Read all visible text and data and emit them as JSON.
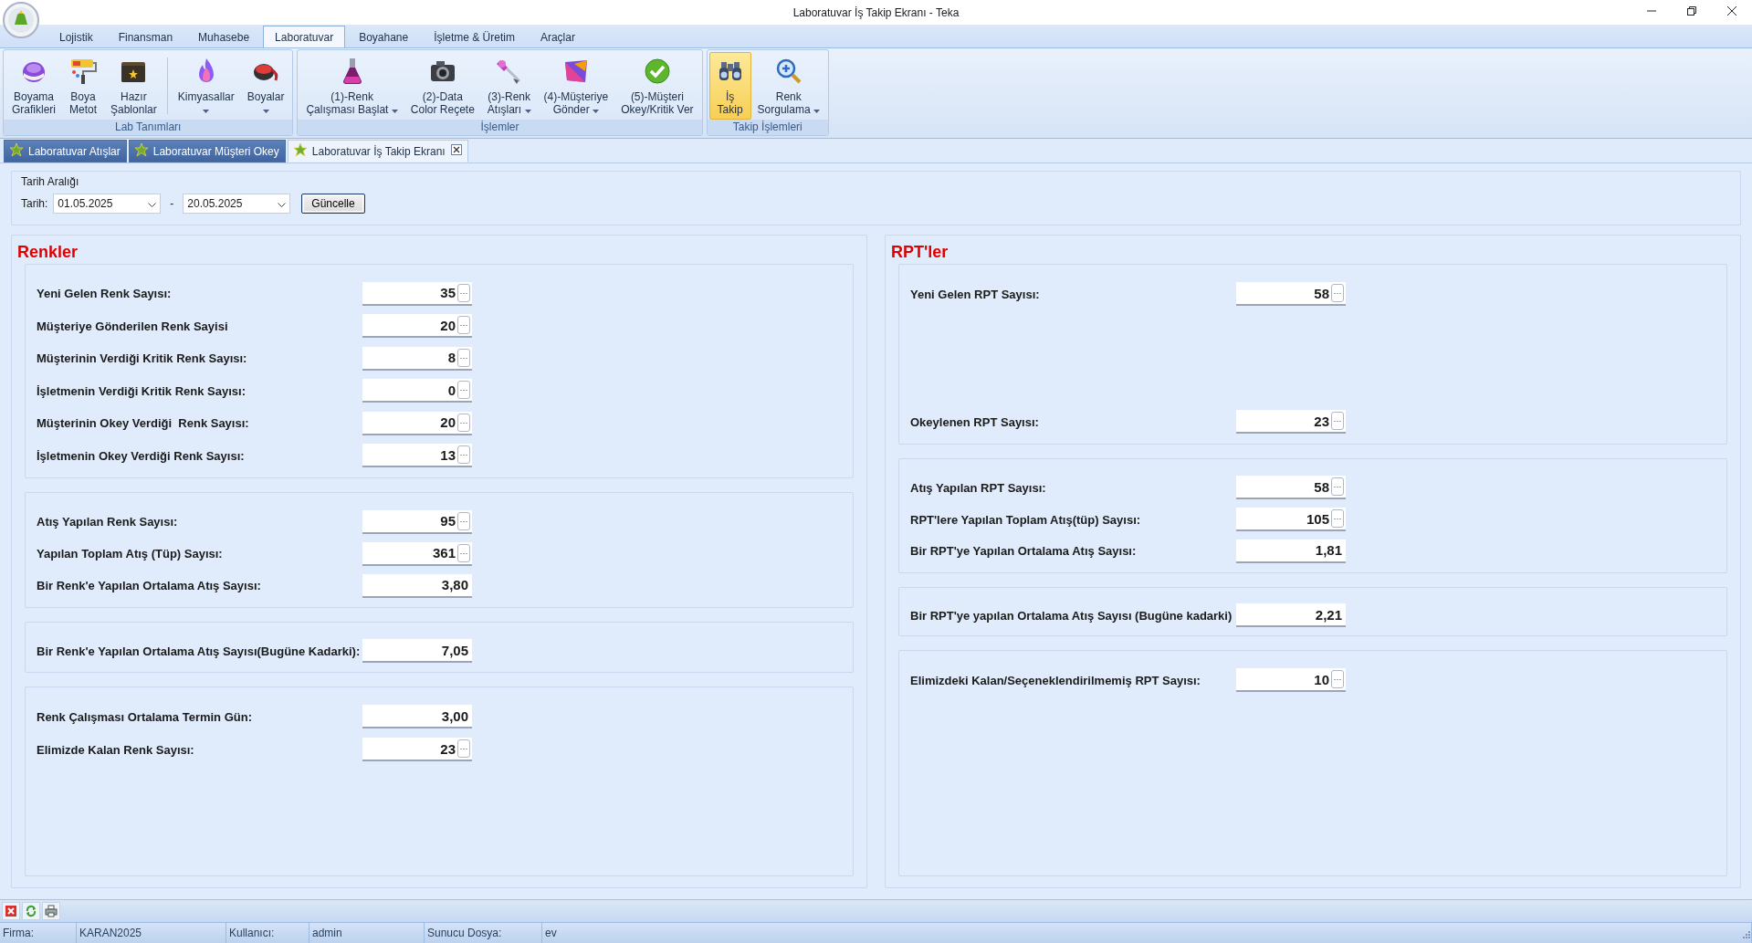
{
  "window": {
    "title": "Laboratuvar İş Takip Ekranı - Teka"
  },
  "menu_tabs": [
    {
      "label": "Lojistik",
      "selected": false
    },
    {
      "label": "Finansman",
      "selected": false
    },
    {
      "label": "Muhasebe",
      "selected": false
    },
    {
      "label": "Laboratuvar",
      "selected": true
    },
    {
      "label": "Boyahane",
      "selected": false
    },
    {
      "label": "İşletme & Üretim",
      "selected": false
    },
    {
      "label": "Araçlar",
      "selected": false
    }
  ],
  "ribbon_groups": [
    {
      "title": "Lab Tanımları",
      "sections": [
        [
          {
            "lines": [
              "Boyama",
              "Grafikleri"
            ],
            "dropdown": false,
            "selected": false
          },
          {
            "lines": [
              "Boya",
              "Metot"
            ],
            "dropdown": false,
            "selected": false
          },
          {
            "lines": [
              "Hazır",
              "Şablonlar"
            ],
            "dropdown": false,
            "selected": false
          }
        ],
        [
          {
            "lines": [
              "Kimyasallar"
            ],
            "dropdown": true,
            "selected": false
          },
          {
            "lines": [
              "Boyalar"
            ],
            "dropdown": true,
            "selected": false
          }
        ]
      ]
    },
    {
      "title": "İşlemler",
      "sections": [
        [
          {
            "lines": [
              "(1)-Renk",
              "Çalışması Başlat"
            ],
            "dropdown": true,
            "selected": false
          },
          {
            "lines": [
              "(2)-Data",
              "Color Reçete"
            ],
            "dropdown": false,
            "selected": false
          },
          {
            "lines": [
              "(3)-Renk",
              "Atışları"
            ],
            "dropdown": true,
            "selected": false
          },
          {
            "lines": [
              "(4)-Müşteriye",
              "Gönder"
            ],
            "dropdown": true,
            "selected": false
          },
          {
            "lines": [
              "(5)-Müşteri",
              "Okey/Kritik Ver"
            ],
            "dropdown": false,
            "selected": false
          }
        ]
      ]
    },
    {
      "title": "Takip İşlemleri",
      "sections": [
        [
          {
            "lines": [
              "İş",
              "Takip"
            ],
            "dropdown": false,
            "selected": true
          },
          {
            "lines": [
              "Renk",
              "Sorgulama"
            ],
            "dropdown": true,
            "selected": false
          }
        ]
      ]
    }
  ],
  "document_tabs": [
    {
      "label": "Laboratuvar Atışlar",
      "selected": false,
      "closable": false
    },
    {
      "label": "Laboratuvar Müşteri Okey",
      "selected": false,
      "closable": false
    },
    {
      "label": "Laboratuvar İş Takip Ekranı",
      "selected": true,
      "closable": true
    }
  ],
  "date_filter": {
    "title": "Tarih Aralığı",
    "label": "Tarih:",
    "from": "01.05.2025",
    "separator": "-",
    "to": "20.05.2025",
    "button": "Güncelle"
  },
  "panels": [
    {
      "title": "Renkler",
      "groups": [
        {
          "rows": [
            {
              "label": "Yeni Gelen Renk Sayısı:",
              "value": "35",
              "button": "···"
            },
            {
              "label": "Müşteriye Gönderilen Renk Sayisi",
              "value": "20",
              "button": "···"
            },
            {
              "label": "Müşterinin Verdiği Kritik Renk Sayısı:",
              "value": "8",
              "button": "···"
            },
            {
              "label": "İşletmenin Verdiği Kritik Renk Sayısı:",
              "value": "0",
              "button": "···"
            },
            {
              "label": "Müşterinin Okey Verdiği  Renk Sayısı:",
              "value": "20",
              "button": "···"
            },
            {
              "label": "İşletmenin Okey Verdiği Renk Sayısı:",
              "value": "13",
              "button": "···"
            }
          ]
        },
        {
          "rows": [
            {
              "label": "Atış Yapılan Renk Sayısı:",
              "value": "95",
              "button": "···"
            },
            {
              "label": "Yapılan Toplam Atış (Tüp) Sayısı:",
              "value": "361",
              "button": "···"
            },
            {
              "label": "Bir Renk'e Yapılan Ortalama Atış Sayısı:",
              "value": "3,80"
            }
          ]
        },
        {
          "rows": [
            {
              "label": "Bir Renk'e Yapılan Ortalama Atış Sayısı(Bugüne Kadarki):",
              "value": "7,05"
            }
          ]
        },
        {
          "rows": [
            {
              "label": "Renk Çalışması Ortalama Termin Gün:",
              "value": "3,00"
            },
            {
              "label": "Elimizde Kalan Renk Sayısı:",
              "value": "23",
              "button": "···"
            }
          ]
        }
      ]
    },
    {
      "title": "RPT'ler",
      "groups": [
        {
          "rows": [
            {
              "label": "Yeni Gelen RPT Sayısı:",
              "value": "58",
              "button": "···"
            },
            {
              "label": "Okeylenen RPT Sayısı:",
              "value": "23",
              "button": "···"
            }
          ]
        },
        {
          "rows": [
            {
              "label": "Atış Yapılan RPT Sayısı:",
              "value": "58",
              "button": "···"
            },
            {
              "label": "RPT'lere Yapılan Toplam Atış(tüp) Sayısı:",
              "value": "105",
              "button": "···"
            },
            {
              "label": "Bir RPT'ye Yapılan Ortalama Atış Sayısı:",
              "value": "1,81"
            }
          ]
        },
        {
          "rows": [
            {
              "label": "Bir RPT'ye yapılan Ortalama Atış Sayısı (Bugüne kadarki)",
              "value": "2,21"
            }
          ]
        },
        {
          "rows": [
            {
              "label": "Elimizdeki Kalan/Seçeneklendirilmemiş RPT Sayısı:",
              "value": "10",
              "button": "···"
            }
          ]
        }
      ]
    }
  ],
  "status_bar": [
    {
      "text": "Firma:",
      "kind": "label"
    },
    {
      "text": "KARAN2025",
      "kind": "value"
    },
    {
      "text": "Kullanıcı:",
      "kind": "label"
    },
    {
      "text": "admin",
      "kind": "value"
    },
    {
      "text": "Sunucu Dosya:",
      "kind": "label"
    },
    {
      "text": "ev",
      "kind": "value"
    }
  ]
}
